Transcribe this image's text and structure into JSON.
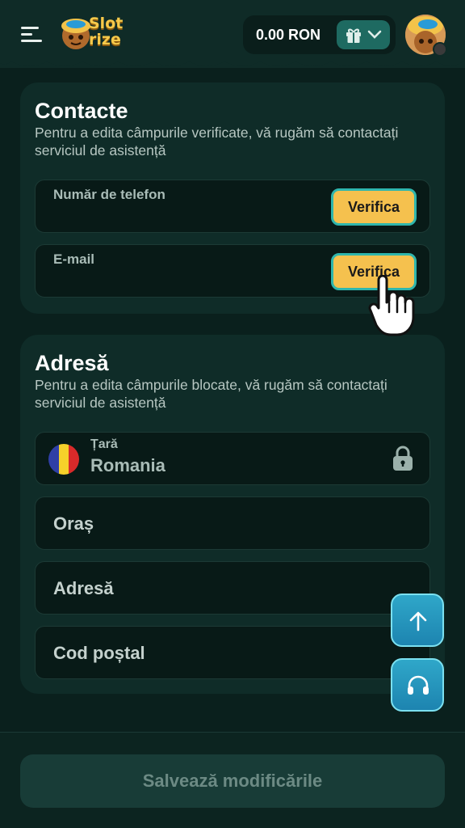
{
  "header": {
    "logo_line1": "Slot",
    "logo_line2": "rize",
    "balance": "0.00 RON"
  },
  "contacts": {
    "title": "Contacte",
    "description": "Pentru a edita câmpurile verificate, vă rugăm să contactați serviciul de asistență",
    "phone_label": "Număr de telefon",
    "email_label": "E-mail",
    "verify_label": "Verifica"
  },
  "address": {
    "title": "Adresă",
    "description": "Pentru a edita câmpurile blocate, vă rugăm să contactați serviciul de asistență",
    "country_label": "Țară",
    "country_value": "Romania",
    "city_placeholder": "Oraș",
    "address_placeholder": "Adresă",
    "postal_placeholder": "Cod poștal"
  },
  "footer": {
    "save_label": "Salvează modificările"
  },
  "colors": {
    "background": "#0a201d",
    "card": "#0f2c28",
    "accent_yellow": "#f5c14e",
    "accent_teal": "#2fb6ad",
    "fab_blue": "#1d84b0"
  },
  "icons": [
    "menu-icon",
    "gift-icon",
    "chevron-down-icon",
    "lock-icon",
    "arrow-up-icon",
    "headphones-icon",
    "pointer-hand-icon"
  ]
}
